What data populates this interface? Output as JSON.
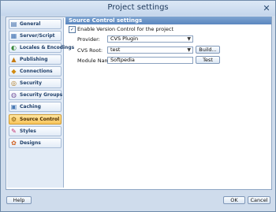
{
  "window": {
    "title": "Project settings",
    "close_glyph": "✕"
  },
  "sidebar": {
    "items": [
      {
        "label": "General",
        "icon": "general-icon",
        "glyph": "▤"
      },
      {
        "label": "Server/Script",
        "icon": "server-script-icon",
        "glyph": "▦"
      },
      {
        "label": "Locales & Encodings",
        "icon": "locales-icon",
        "glyph": "◐"
      },
      {
        "label": "Publishing",
        "icon": "publishing-icon",
        "glyph": "▲"
      },
      {
        "label": "Connections",
        "icon": "connections-icon",
        "glyph": "◆"
      },
      {
        "label": "Security",
        "icon": "security-icon",
        "glyph": "◎"
      },
      {
        "label": "Security Groups",
        "icon": "security-groups-icon",
        "glyph": "◍"
      },
      {
        "label": "Caching",
        "icon": "caching-icon",
        "glyph": "▣"
      },
      {
        "label": "Source Control",
        "icon": "source-control-icon",
        "glyph": "⚙",
        "active": true
      },
      {
        "label": "Styles",
        "icon": "styles-icon",
        "glyph": "✎"
      },
      {
        "label": "Designs",
        "icon": "designs-icon",
        "glyph": "✿"
      }
    ]
  },
  "panel": {
    "title": "Source Control settings",
    "enable_checkbox": {
      "label": "Enable Version Control for the project",
      "checked": true,
      "check_glyph": "✓"
    },
    "provider": {
      "label": "Provider:",
      "value": "CVS Plugin",
      "arrow": "▼"
    },
    "cvs_root": {
      "label": "CVS Root:",
      "value": "test",
      "arrow": "▼",
      "build_button": "Build..."
    },
    "module_name": {
      "label": "Module Name:",
      "value": "Softpedia",
      "test_button": "Test"
    }
  },
  "footer": {
    "help_button": "Help",
    "ok_button": "OK",
    "cancel_button": "Cancel"
  }
}
